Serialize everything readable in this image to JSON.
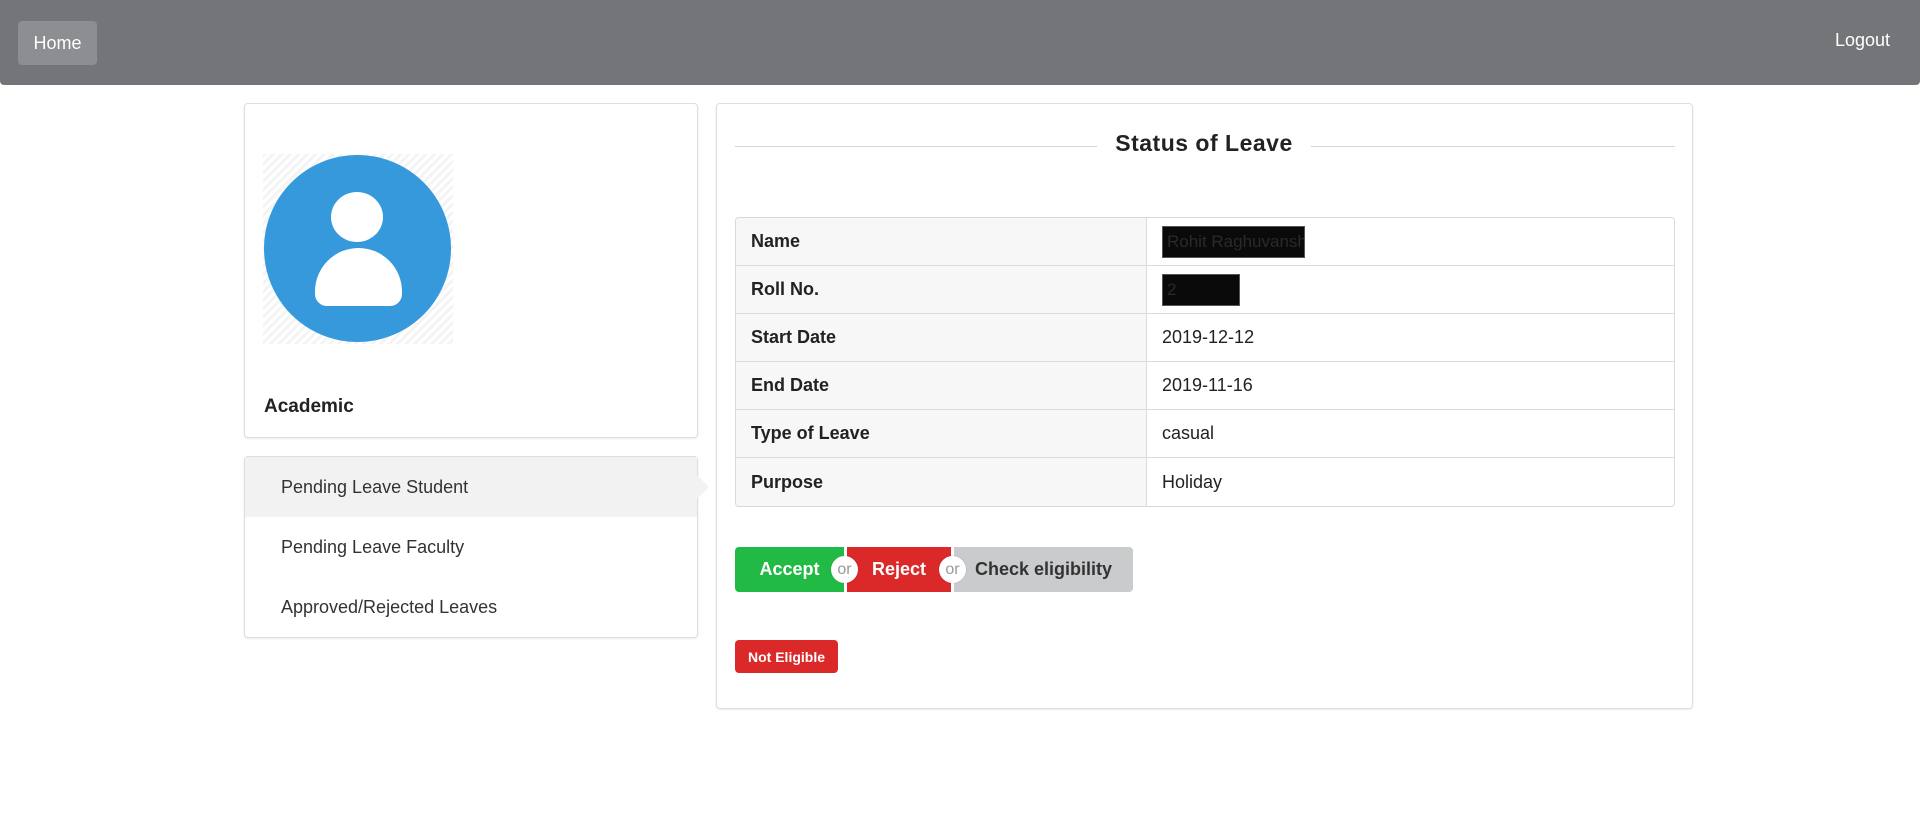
{
  "navbar": {
    "home_label": "Home",
    "logout_label": "Logout"
  },
  "profile": {
    "role": "Academic"
  },
  "menu": {
    "items": [
      {
        "label": "Pending Leave Student",
        "active": true
      },
      {
        "label": "Pending Leave Faculty",
        "active": false
      },
      {
        "label": "Approved/Rejected Leaves",
        "active": false
      }
    ]
  },
  "leave": {
    "title": "Status of Leave",
    "rows": [
      {
        "key": "Name",
        "value": "Rohit Raghuvanshi",
        "redacted": true
      },
      {
        "key": "Roll No.",
        "value": "2",
        "redacted": true
      },
      {
        "key": "Start Date",
        "value": "2019-12-12",
        "redacted": false
      },
      {
        "key": "End Date",
        "value": "2019-11-16",
        "redacted": false
      },
      {
        "key": "Type of Leave",
        "value": "casual",
        "redacted": false
      },
      {
        "key": "Purpose",
        "value": "Holiday",
        "redacted": false
      }
    ]
  },
  "actions": {
    "accept_label": "Accept",
    "or_label": "or",
    "reject_label": "Reject",
    "check_label": "Check eligibility"
  },
  "status": {
    "label": "Not Eligible",
    "color": "#db2828"
  },
  "colors": {
    "navbar": "#747579",
    "accept": "#21ba45",
    "reject": "#db2828",
    "neutral": "#cacbcd",
    "avatar": "#3699dc"
  }
}
